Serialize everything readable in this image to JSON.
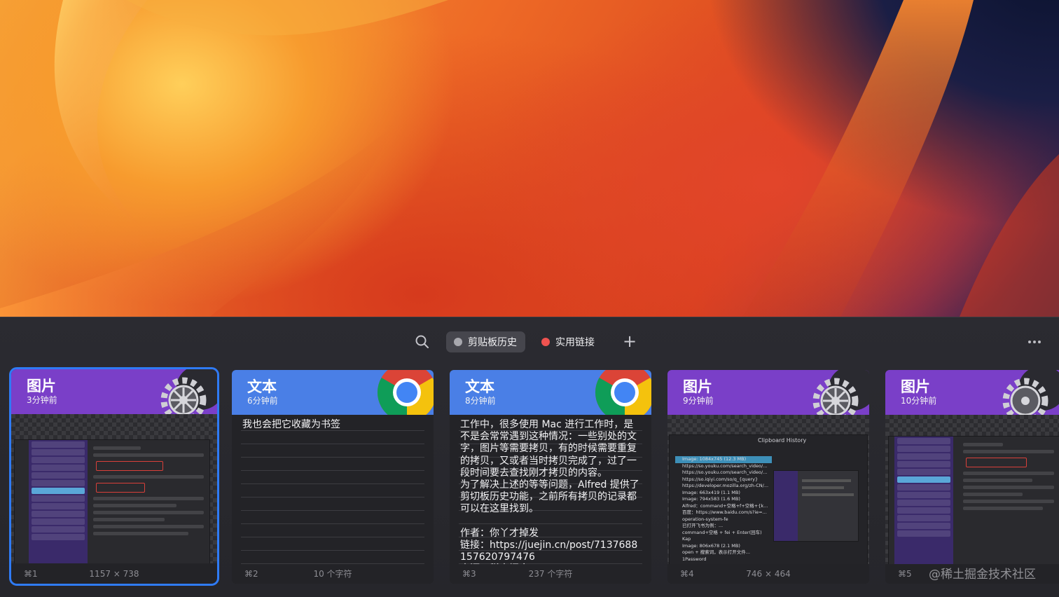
{
  "toolbar": {
    "tabs": [
      {
        "label": "剪贴板历史",
        "dot_color": "#a8a8ae",
        "active": true
      },
      {
        "label": "实用链接",
        "dot_color": "#ef5350",
        "active": false
      }
    ]
  },
  "cards": [
    {
      "type": "图片",
      "time": "3分钟前",
      "shortcut": "⌘1",
      "meta": "1157 × 738",
      "icon": "alfred-gear-icon",
      "header_color": "#7a3fc8"
    },
    {
      "type": "文本",
      "time": "6分钟前",
      "shortcut": "⌘2",
      "meta": "10 个字符",
      "icon": "chrome-icon",
      "header_color": "#4a7fe6",
      "content": "我也会把它收藏为书签"
    },
    {
      "type": "文本",
      "time": "8分钟前",
      "shortcut": "⌘3",
      "meta": "237 个字符",
      "icon": "chrome-icon",
      "header_color": "#4a7fe6",
      "content": "工作中，很多使用 Mac 进行工作时，是不是会常常遇到这种情况：一些别处的文字，图片等需要拷贝，有的时候需要重复的拷贝，又或者当时拷贝完成了，过了一段时间要去查找刚才拷贝的内容。\n为了解决上述的等等问题，Alfred 提供了剪切板历史功能，之前所有拷贝的记录都可以在这里找到。\n\n作者：你丫才掉发\n链接：https://juejin.cn/post/7137688157620797476\n来源：稀土掘金"
    },
    {
      "type": "图片",
      "time": "9分钟前",
      "shortcut": "⌘4",
      "meta": "746 × 464",
      "icon": "alfred-gear-icon",
      "header_color": "#7a3fc8"
    },
    {
      "type": "图片",
      "time": "10分钟前",
      "shortcut": "⌘5",
      "meta": "",
      "icon": "alfred-gear-icon",
      "header_color": "#7a3fc8"
    }
  ],
  "card4_preview": {
    "title": "Clipboard History",
    "items": [
      "Image: 1084x745 (12.3 MB)",
      "https://so.youku.com/search_video/...",
      "https://so.youku.com/search_video/...",
      "https://so.iqiyi.com/so/q_{query}",
      "https://developer.mozilla.org/zh-CN/...",
      "Image: 663x419 (1.1 MB)",
      "Image: 794x583 (1.6 MB)",
      "Alfred：command+空格+f+空格+{k...",
      "百度：https://www.baidu.com/s?ie=...",
      "operation-system-fe",
      "已打开飞书为例：...",
      "command+空格 + fei + Enter(回车)",
      "Kap",
      "Image: 806x678 (2.1 MB)",
      "open + 搜索词，表示打开文件...",
      "1Password"
    ]
  },
  "watermark": "@稀土掘金技术社区"
}
